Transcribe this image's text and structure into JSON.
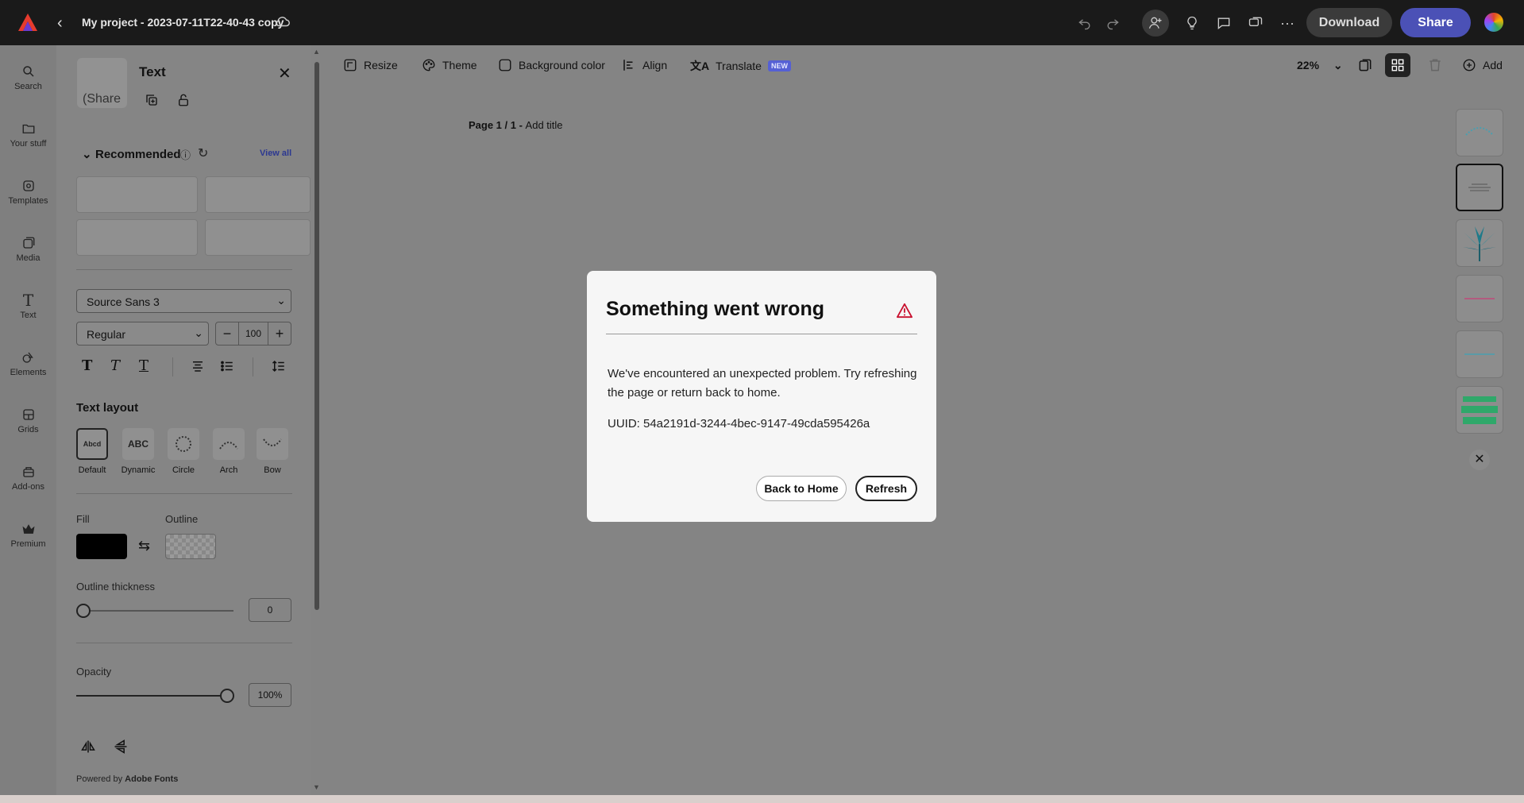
{
  "topbar": {
    "project_title": "My project - 2023-07-11T22-40-43 copy",
    "download_label": "Download",
    "share_label": "Share"
  },
  "rail": {
    "items": [
      {
        "label": "Search",
        "icon": "search-icon"
      },
      {
        "label": "Your stuff",
        "icon": "folder-icon"
      },
      {
        "label": "Templates",
        "icon": "templates-icon"
      },
      {
        "label": "Media",
        "icon": "media-icon"
      },
      {
        "label": "Text",
        "icon": "text-icon"
      },
      {
        "label": "Elements",
        "icon": "elements-icon"
      },
      {
        "label": "Grids",
        "icon": "grids-icon"
      },
      {
        "label": "Add-ons",
        "icon": "addons-icon"
      },
      {
        "label": "Premium",
        "icon": "crown-icon"
      }
    ]
  },
  "panel": {
    "title": "Text",
    "thumb_text": "(Share",
    "recommended_label": "Recommended",
    "view_all_label": "View all",
    "font_family": "Source Sans 3",
    "font_weight": "Regular",
    "font_size": "100",
    "text_layout_label": "Text layout",
    "layouts": [
      {
        "label": "Default",
        "preview": "Abcd"
      },
      {
        "label": "Dynamic",
        "preview": "ABC"
      },
      {
        "label": "Circle",
        "preview": ""
      },
      {
        "label": "Arch",
        "preview": ""
      },
      {
        "label": "Bow",
        "preview": ""
      }
    ],
    "fill_label": "Fill",
    "outline_label": "Outline",
    "outline_thickness_label": "Outline thickness",
    "outline_thickness_value": "0",
    "opacity_label": "Opacity",
    "opacity_value": "100%",
    "powered_prefix": "Powered by",
    "powered_brand": "Adobe Fonts"
  },
  "toolbar": {
    "resize": "Resize",
    "theme": "Theme",
    "background_color": "Background color",
    "align": "Align",
    "translate": "Translate",
    "new_badge": "NEW",
    "zoom": "22%",
    "add": "Add"
  },
  "canvas": {
    "page_label": "Page 1 / 1 -",
    "add_title": "Add title"
  },
  "dialog": {
    "title": "Something went wrong",
    "body": "We've encountered an unexpected problem. Try refreshing the page or return back to home.",
    "uuid": "UUID: 54a2191d-3244-4bec-9147-49cda595426a",
    "back_home": "Back to Home",
    "refresh": "Refresh"
  },
  "colors": {
    "accent": "#4b51b6",
    "warning": "#c8102e",
    "topbar_bg": "#1a1a1a"
  }
}
